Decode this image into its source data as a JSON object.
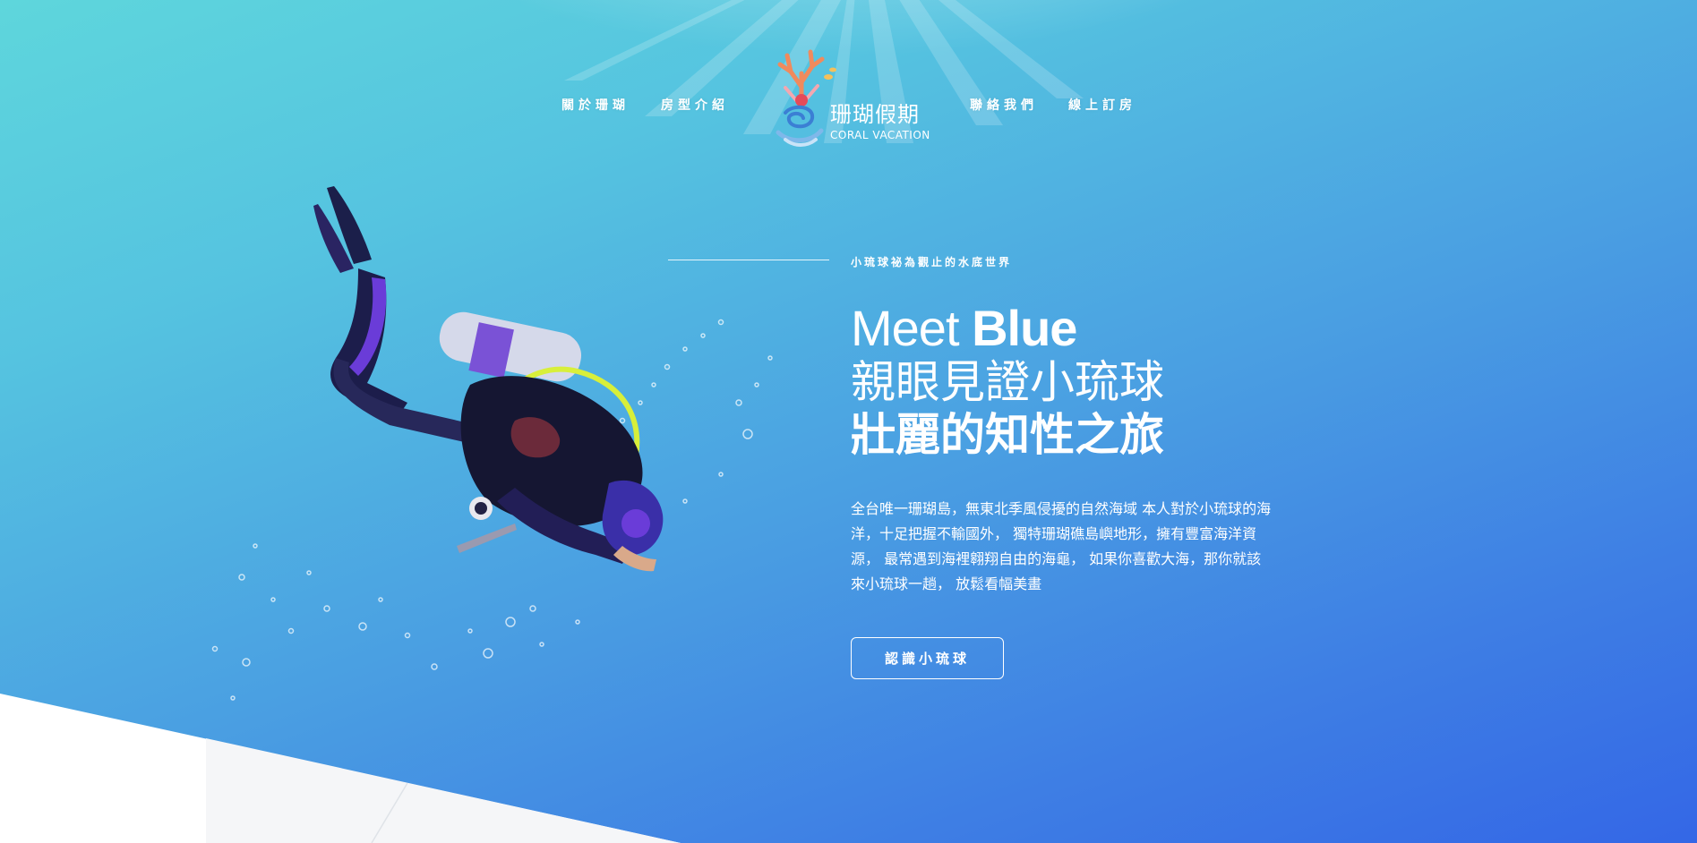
{
  "nav": {
    "items": [
      {
        "label": "關於珊瑚"
      },
      {
        "label": "房型介紹"
      },
      {
        "label": "聯絡我們"
      },
      {
        "label": "線上訂房"
      }
    ]
  },
  "logo": {
    "name": "珊瑚假期",
    "subtitle": "CORAL VACATION"
  },
  "hero": {
    "eyebrow": "小琉球祕為觀止的水底世界",
    "headline_light": "Meet ",
    "headline_bold": "Blue",
    "headline_line2": "親眼見證小琉球",
    "headline_line3": "壯麗的知性之旅",
    "description": "全台唯一珊瑚島，無東北季風侵擾的自然海域 本人對於小琉球的海洋，十足把握不輸國外， 獨特珊瑚礁島嶼地形，擁有豐富海洋資源， 最常遇到海裡翱翔自由的海龜， 如果你喜歡大海，那你就該來小琉球一趟， 放鬆看幅美畫",
    "cta_label": "認識小琉球"
  },
  "colors": {
    "gradient_top": "#5ed6dc",
    "gradient_bottom": "#3467e6",
    "text": "#ffffff"
  }
}
